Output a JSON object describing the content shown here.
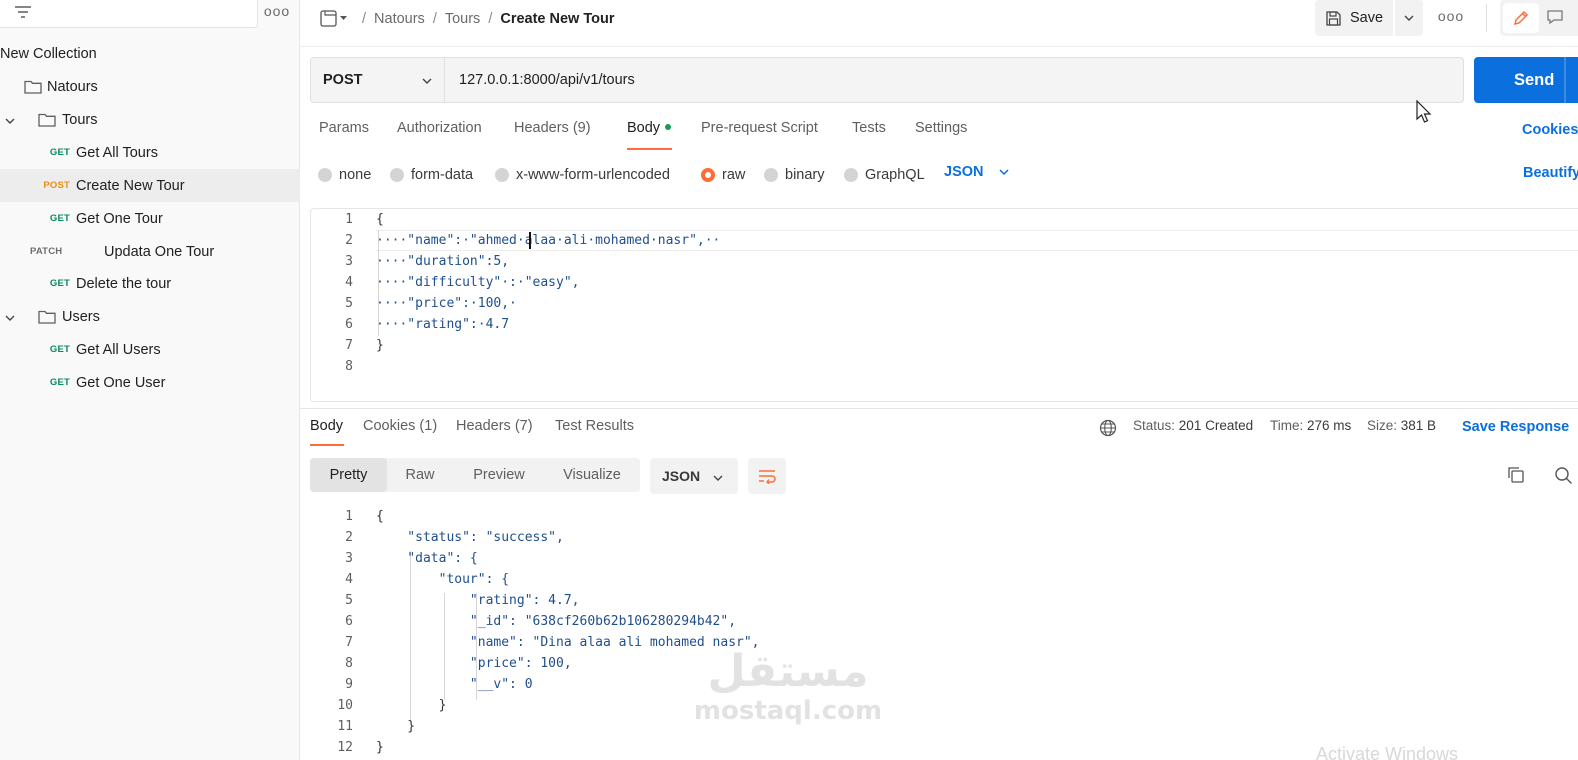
{
  "sidebar": {
    "more": "ooo",
    "collection": "New Collection",
    "items": [
      {
        "type": "folder",
        "label": "Natours",
        "depth": 0
      },
      {
        "type": "folder",
        "label": "Tours",
        "depth": 1,
        "expanded": true
      },
      {
        "type": "request",
        "method": "GET",
        "label": "Get All Tours"
      },
      {
        "type": "request",
        "method": "POST",
        "label": "Create New Tour",
        "active": true
      },
      {
        "type": "request",
        "method": "GET",
        "label": "Get One Tour"
      },
      {
        "type": "request",
        "method": "PATCH",
        "label": "Updata One Tour"
      },
      {
        "type": "request",
        "method": "GET",
        "label": "Delete the tour"
      },
      {
        "type": "folder",
        "label": "Users",
        "depth": 1,
        "expanded": true
      },
      {
        "type": "request",
        "method": "GET",
        "label": "Get All Users"
      },
      {
        "type": "request",
        "method": "GET",
        "label": "Get One User"
      }
    ]
  },
  "header": {
    "breadcrumb": [
      "Natours",
      "Tours",
      "Create New Tour"
    ],
    "save_label": "Save",
    "more": "ooo"
  },
  "request": {
    "method": "POST",
    "url": "127.0.0.1:8000/api/v1/tours",
    "send_label": "Send",
    "tabs": [
      {
        "label": "Params"
      },
      {
        "label": "Authorization"
      },
      {
        "label": "Headers",
        "count": "(9)"
      },
      {
        "label": "Body",
        "active": true
      },
      {
        "label": "Pre-request Script"
      },
      {
        "label": "Tests"
      },
      {
        "label": "Settings"
      }
    ],
    "cookies_link": "Cookies",
    "body_types": [
      "none",
      "form-data",
      "x-www-form-urlencoded",
      "raw",
      "binary",
      "GraphQL"
    ],
    "selected_body_type": "raw",
    "format": "JSON",
    "beautify_link": "Beautify",
    "body_lines": [
      "{",
      "····\"name\":·\"ahmed·alaa·ali·mohamed·nasr\",··",
      "····\"duration\":5,",
      "····\"difficulty\"·:·\"easy\",",
      "····\"price\":·100,·",
      "····\"rating\":·4.7",
      "}",
      ""
    ]
  },
  "response": {
    "tabs": [
      {
        "label": "Body",
        "active": true
      },
      {
        "label": "Cookies",
        "count": "(1)"
      },
      {
        "label": "Headers",
        "count": "(7)"
      },
      {
        "label": "Test Results"
      }
    ],
    "status_label": "Status:",
    "status_value": "201 Created",
    "time_label": "Time:",
    "time_value": "276 ms",
    "size_label": "Size:",
    "size_value": "381 B",
    "save_response": "Save Response",
    "views": [
      "Pretty",
      "Raw",
      "Preview",
      "Visualize"
    ],
    "active_view": "Pretty",
    "format": "JSON",
    "body_lines": [
      "{",
      "    \"status\": \"success\",",
      "    \"data\": {",
      "        \"tour\": {",
      "            \"rating\": 4.7,",
      "            \"_id\": \"638cf260b62b106280294b42\",",
      "            \"name\": \"Dina alaa ali mohamed nasr\",",
      "            \"price\": 100,",
      "            \"__v\": 0",
      "        }",
      "    }",
      "}"
    ]
  },
  "watermark": {
    "arabic": "مستقل",
    "latin": "mostaql.com"
  },
  "os_notice": "Activate Windows",
  "colors": {
    "accent": "#ff6c37",
    "send": "#0b6fde",
    "get": "#0a8a5e",
    "post": "#e99018"
  }
}
